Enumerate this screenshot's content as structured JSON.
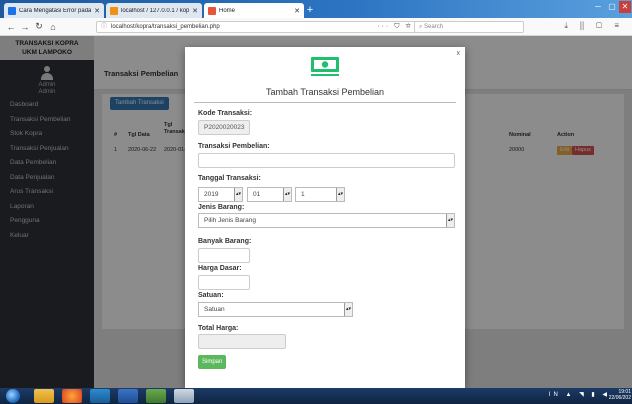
{
  "browser": {
    "tabs": [
      {
        "label": "Cara Mengatasi Error pada XAI",
        "active": false
      },
      {
        "label": "localhost / 127.0.0.1 / kopra / ...",
        "active": false
      },
      {
        "label": "Home",
        "active": true
      }
    ],
    "url": "localhost/kopra/transaksi_pembelian.php",
    "url_actions": "··· ⛉ ☆",
    "search_placeholder": "Search",
    "toolbar_right": "⤓ ⫼ ▢ ≡",
    "window_controls": [
      "─",
      "▢",
      "✕"
    ]
  },
  "app": {
    "brand": [
      "TRANSAKSI KOPRA",
      "UKM LAMPOKO"
    ],
    "user": {
      "name": "Admin",
      "role": "Admin"
    },
    "menu": [
      "Dasboard",
      "Transaksi Pembelian",
      "Stok Kopra",
      "Transaksi Penjualan",
      "Data Pembelian",
      "Data Penjualan",
      "Arus Transaksi",
      "Laporan",
      "Pengguna",
      "Keluar"
    ],
    "page_title": "Transaksi Pembelian",
    "add_button": "Tambah Transaksi",
    "table": {
      "headers": [
        "#",
        "Tgl Data",
        "Tgl Transaksi",
        "Nominal",
        "Action"
      ],
      "rows": [
        {
          "no": "1",
          "tgl_data": "2020-06-22",
          "tgl_transaksi": "2020-01-",
          "nominal": "20000",
          "edit": "Edit",
          "delete": "Hapus"
        }
      ]
    }
  },
  "modal": {
    "close": "x",
    "title": "Tambah Transaksi Pembelian",
    "fields": {
      "kode_label": "Kode Transaksi:",
      "kode_value": "P2020020023",
      "transaksi_label": "Transaksi Pembelian:",
      "transaksi_value": "",
      "tanggal_label": "Tanggal Transaksi:",
      "tahun": "2019",
      "bulan": "01",
      "hari": "1",
      "jenis_label": "Jenis Barang:",
      "jenis_value": "Pilih Jenis Barang",
      "banyak_label": "Banyak Barang:",
      "banyak_value": "",
      "harga_label": "Harga Dasar:",
      "harga_value": "",
      "satuan_label": "Satuan:",
      "satuan_value": "Satuan",
      "total_label": "Total Harga:",
      "total_value": ""
    },
    "submit": "Simpan",
    "accent": "#1fbf6e"
  },
  "taskbar": {
    "tray": "IN ▲ ◥ ▮ ◀",
    "time": "19:01",
    "date": "22/06/202"
  }
}
